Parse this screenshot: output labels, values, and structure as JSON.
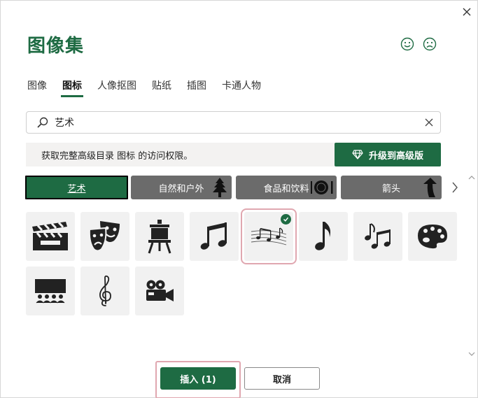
{
  "dialog": {
    "title": "图像集"
  },
  "feedback": {
    "smile_icon": "smile-icon",
    "frown_icon": "frown-icon"
  },
  "tabs": [
    {
      "label": "图像",
      "active": false
    },
    {
      "label": "图标",
      "active": true
    },
    {
      "label": "人像抠图",
      "active": false
    },
    {
      "label": "贴纸",
      "active": false
    },
    {
      "label": "插图",
      "active": false
    },
    {
      "label": "卡通人物",
      "active": false
    }
  ],
  "search": {
    "value": "艺术"
  },
  "upgrade": {
    "message": "获取完整高级目录 图标 的访问权限。",
    "button_label": "升级到高级版"
  },
  "categories": [
    {
      "label": "艺术",
      "active": true
    },
    {
      "label": "自然和户外",
      "icon": "tree-icon"
    },
    {
      "label": "食品和饮料",
      "icon": "dining-icon"
    },
    {
      "label": "箭头",
      "icon": "curved-arrow-icon"
    }
  ],
  "icons": [
    {
      "name": "clapperboard-icon",
      "selected": false
    },
    {
      "name": "theater-masks-icon",
      "selected": false
    },
    {
      "name": "easel-icon",
      "selected": false
    },
    {
      "name": "music-notes-icon",
      "selected": false
    },
    {
      "name": "sheet-music-icon",
      "selected": true
    },
    {
      "name": "eighth-note-icon",
      "selected": false
    },
    {
      "name": "multiple-notes-icon",
      "selected": false
    },
    {
      "name": "paint-palette-icon",
      "selected": false
    },
    {
      "name": "cinema-audience-icon",
      "selected": false
    },
    {
      "name": "treble-clef-icon",
      "selected": false
    },
    {
      "name": "movie-camera-icon",
      "selected": false
    }
  ],
  "actions": {
    "insert_label": "插入 (1)",
    "cancel_label": "取消"
  },
  "colors": {
    "accent": "#1e6b43",
    "category_bg": "#6b6b6b",
    "selection_outline": "#e0a7b0"
  }
}
